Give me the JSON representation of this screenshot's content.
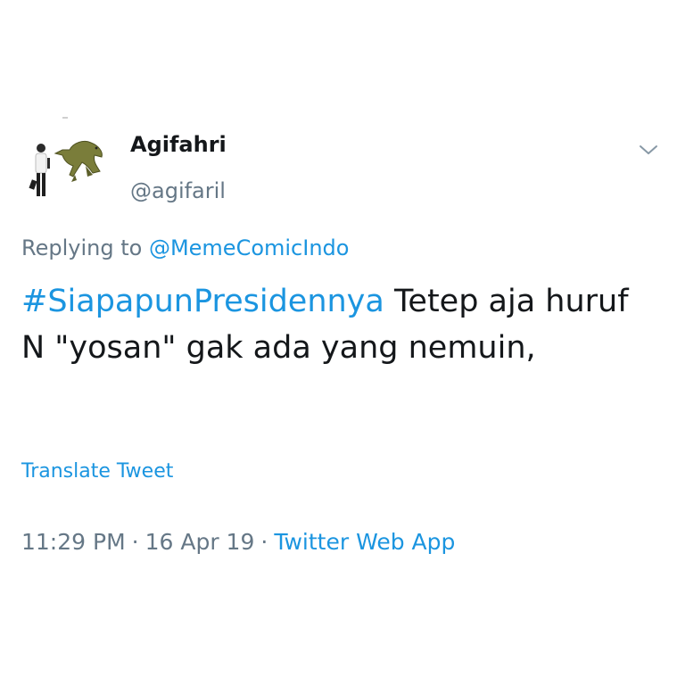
{
  "tweet": {
    "display_name": "Agifahri",
    "handle": "@agifaril",
    "replying_prefix": "Replying to",
    "replying_to": "@MemeComicIndo",
    "hashtag": "#SiapapunPresidennya",
    "body_rest": "Tetep aja huruf N \"yosan\" gak ada yang nemuin,",
    "translate_label": "Translate Tweet",
    "time": "11:29 PM",
    "date": "16 Apr 19",
    "source": "Twitter Web App",
    "separator": "·"
  },
  "icons": {
    "caret": "chevron-down-icon",
    "avatar": "avatar-person-dinosaur"
  },
  "colors": {
    "link": "#1b95e0",
    "secondary_text": "#657786",
    "primary_text": "#14171a",
    "background": "#ffffff"
  }
}
